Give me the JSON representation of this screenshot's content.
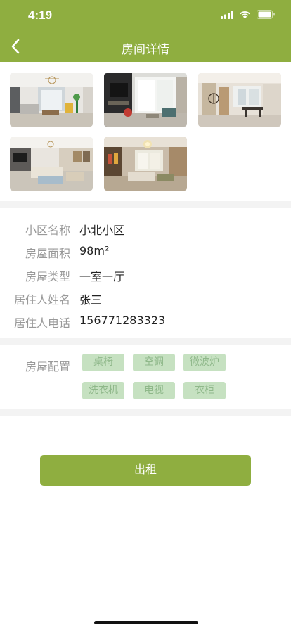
{
  "status_bar": {
    "time": "4:19"
  },
  "nav": {
    "title": "房间详情"
  },
  "icons": {
    "back": "chevron-left-icon",
    "signal": "cellular-signal-icon",
    "wifi": "wifi-icon",
    "battery": "battery-icon"
  },
  "colors": {
    "brand": "#8fae40",
    "tag_bg": "#c6e1c1",
    "tag_text": "#8fb88a",
    "label": "#999999",
    "separator": "#f3f3f3"
  },
  "gallery": {
    "photos": [
      "living-room-photo",
      "tv-wall-photo",
      "dining-area-photo",
      "living-room-wide-photo",
      "living-room-chandelier-photo"
    ]
  },
  "info": {
    "rows": [
      {
        "label": "小区名称",
        "value": "小北小区"
      },
      {
        "label": "房屋面积",
        "value": "98m²"
      },
      {
        "label": "房屋类型",
        "value": "一室一厅"
      },
      {
        "label": "居住人姓名",
        "value": "张三"
      },
      {
        "label": "居住人电话",
        "value": "156771283323"
      }
    ]
  },
  "config": {
    "label": "房屋配置",
    "tags": [
      "桌椅",
      "空调",
      "微波炉",
      "洗衣机",
      "电视",
      "衣柜"
    ]
  },
  "action": {
    "rent_label": "出租"
  }
}
